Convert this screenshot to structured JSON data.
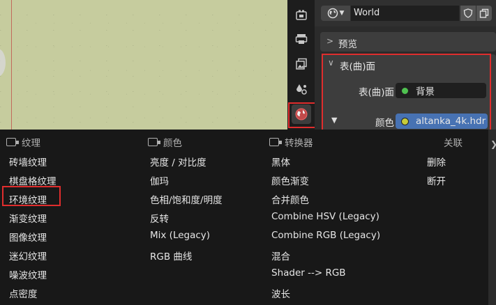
{
  "properties_header": {
    "world_name": "World"
  },
  "panels": {
    "preview_label": "预览",
    "surface_label": "表(曲)面",
    "surface_prop_label": "表(曲)面",
    "surface_value": "背景",
    "color_prop_label": "颜色",
    "color_value": "altanka_4k.hdr"
  },
  "menu": {
    "columns": [
      {
        "header": "纹理",
        "items": [
          "砖墙纹理",
          "棋盘格纹理",
          "环境纹理",
          "渐变纹理",
          "图像纹理",
          "迷幻纹理",
          "噪波纹理",
          "点密度"
        ]
      },
      {
        "header": "颜色",
        "items": [
          "亮度 / 对比度",
          "伽玛",
          "色相/饱和度/明度",
          "反转",
          "Mix (Legacy)",
          "RGB 曲线"
        ]
      },
      {
        "header": "转换器",
        "items": [
          "黑体",
          "颜色渐变",
          "合并颜色",
          "Combine HSV (Legacy)",
          "Combine RGB (Legacy)",
          "混合",
          "Shader --> RGB",
          "波长"
        ]
      },
      {
        "header": "关联",
        "items": [
          "删除",
          "断开"
        ]
      }
    ]
  },
  "colors": {
    "highlight": "#e02d2d",
    "surface_dot": "#4fc250",
    "color_dot": "#c7cc3a",
    "color_field": "#4772b3"
  },
  "icons": [
    "render-icon",
    "output-icon",
    "view-layer-icon",
    "scene-icon",
    "world-icon",
    "shield-icon",
    "copy-icon",
    "arrow-right-icon"
  ]
}
